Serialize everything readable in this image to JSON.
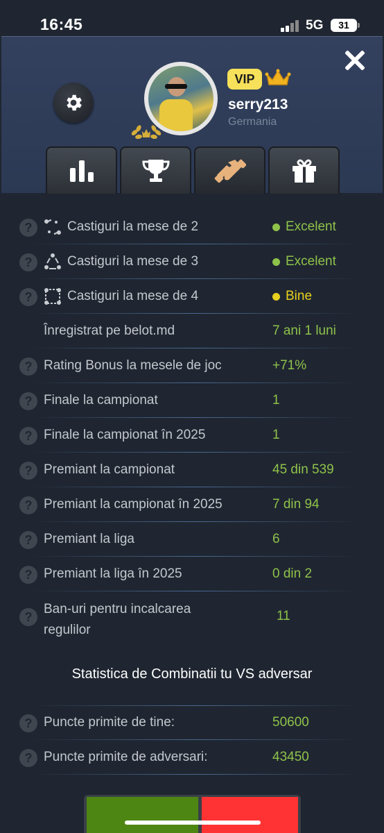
{
  "status": {
    "time": "16:45",
    "network": "5G",
    "battery": "31"
  },
  "profile": {
    "vip_label": "VIP",
    "username": "serry213",
    "country": "Germania"
  },
  "icons": {
    "close": "close-icon",
    "settings": "gear-icon",
    "tabs": [
      "bar-chart-icon",
      "trophy-icon",
      "handshake-icon",
      "gift-icon"
    ]
  },
  "stats": [
    {
      "label": "Castiguri la mese de 2",
      "value": "Excelent",
      "status_color": "#8fc24a"
    },
    {
      "label": "Castiguri la mese de 3",
      "value": "Excelent",
      "status_color": "#8fc24a"
    },
    {
      "label": "Castiguri la mese de 4",
      "value": "Bine",
      "status_color": "#e7d01e"
    },
    {
      "label": "Înregistrat pe belot.md",
      "value": "7 ani 1 luni"
    },
    {
      "label": "Rating Bonus la mesele de joc",
      "value": "+71%"
    },
    {
      "label": "Finale la campionat",
      "value": "1"
    },
    {
      "label": "Finale la campionat în 2025",
      "value": "1"
    },
    {
      "label": "Premiant la campionat",
      "value": "45 din 539"
    },
    {
      "label": "Premiant la campionat în 2025",
      "value": "7 din 94"
    },
    {
      "label": "Premiant la liga",
      "value": "6"
    },
    {
      "label": "Premiant la liga în 2025",
      "value": "0 din 2"
    },
    {
      "label_line1": "Ban-uri pentru incalcarea",
      "label_line2": "regulilor",
      "value": "11"
    }
  ],
  "combinations": {
    "title": "Statistica de Combinatii tu VS adversar",
    "rows": [
      {
        "label": "Puncte primite de tine:",
        "value": "50600"
      },
      {
        "label": "Puncte primite de adversari:",
        "value": "43450"
      }
    ],
    "you_color": "#4e8613",
    "opponent_color": "#ff3333"
  }
}
